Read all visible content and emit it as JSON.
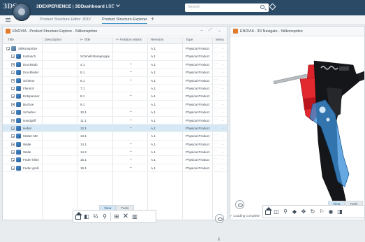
{
  "topbar": {
    "brand_logo": "3DS",
    "app_name": "3DEXPERIENCE",
    "separator": " | ",
    "dashboard": "3DDashboard",
    "tenant": "LBE",
    "search_placeholder": "Search"
  },
  "tabs": [
    {
      "label": "Product Structure Editor"
    },
    {
      "label": "3DIV"
    },
    {
      "label": "Product Structure Explorer"
    }
  ],
  "left_panel": {
    "title": "ENOVIA - Product Structure Explore - Stilkonspritze",
    "columns": [
      "Title",
      "Description",
      "Title",
      "Position Matrix",
      "Revision",
      "Type",
      "Menu"
    ],
    "rows": [
      {
        "title": "Stilkonspritze",
        "description": "",
        "title2": "",
        "pm": false,
        "revision": "A.1",
        "type": "Physical Product",
        "root": true
      },
      {
        "title": "Kartusch",
        "description": "",
        "title2": "Schmelzstoregruppe",
        "pm": false,
        "revision": "A.1",
        "type": "Physical Product"
      },
      {
        "title": "Druckstab",
        "description": "",
        "title2": "4.1",
        "pm": true,
        "revision": "A.1",
        "type": "Physical Product"
      },
      {
        "title": "Druckfeder",
        "description": "",
        "title2": "5.1",
        "pm": true,
        "revision": "A.1",
        "type": "Physical Product"
      },
      {
        "title": "Schiene",
        "description": "",
        "title2": "6.1",
        "pm": true,
        "revision": "A.1",
        "type": "Physical Product"
      },
      {
        "title": "Flansch",
        "description": "",
        "title2": "7.1",
        "pm": false,
        "revision": "A.1",
        "type": "Physical Product"
      },
      {
        "title": "Entspanner",
        "description": "",
        "title2": "8.1",
        "pm": true,
        "revision": "A.1",
        "type": "Physical Product"
      },
      {
        "title": "Buchse",
        "description": "",
        "title2": "9.1",
        "pm": false,
        "revision": "A.1",
        "type": "Physical Product"
      },
      {
        "title": "Schieber",
        "description": "",
        "title2": "10.1",
        "pm": true,
        "revision": "A.1",
        "type": "Physical Product"
      },
      {
        "title": "Handgriff",
        "description": "",
        "title2": "11.1",
        "pm": true,
        "revision": "A.1",
        "type": "Physical Product"
      },
      {
        "title": "Hebel",
        "description": "",
        "title2": "12.1",
        "pm": true,
        "revision": "A.1",
        "type": "Physical Product",
        "selected": true
      },
      {
        "title": "Mutter M8",
        "description": "",
        "title2": "13.1",
        "pm": false,
        "revision": "A.1",
        "type": "Physical Product"
      },
      {
        "title": "Walle",
        "description": "",
        "title2": "14.1",
        "pm": true,
        "revision": "A.1",
        "type": "Physical Product"
      },
      {
        "title": "Walle",
        "description": "",
        "title2": "14.2",
        "pm": true,
        "revision": "A.1",
        "type": "Physical Product"
      },
      {
        "title": "Feder klein",
        "description": "",
        "title2": "15.1",
        "pm": true,
        "revision": "A.1",
        "type": "Physical Product"
      },
      {
        "title": "Feder groß",
        "description": "",
        "title2": "16.1",
        "pm": true,
        "revision": "A.1",
        "type": "Physical Product"
      }
    ],
    "view_tabs": [
      "View",
      "Tools"
    ]
  },
  "right_panel": {
    "title": "ENOVIA - 3D Navigate - Stilkonspritze",
    "view_tabs": [
      "View",
      "Tools"
    ],
    "status": "Loading complete"
  },
  "colors": {
    "topbar": "#2b4a66",
    "selection": "#d6e8f6",
    "accent_red": "#d9242b",
    "accent_blue": "#3b8fd9"
  }
}
